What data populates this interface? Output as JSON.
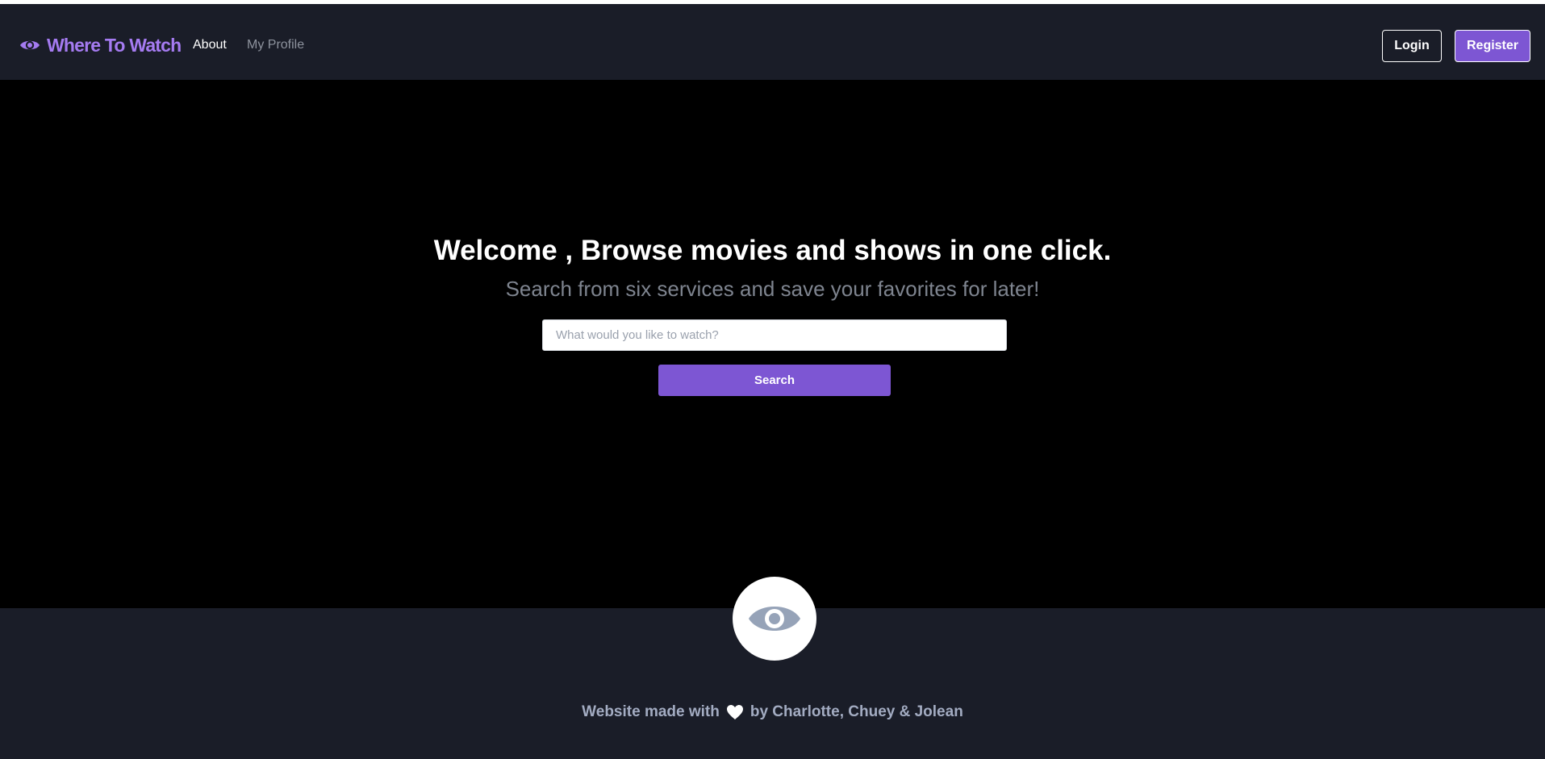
{
  "navbar": {
    "brand": "Where To Watch",
    "links": {
      "about": "About",
      "profile": "My Profile"
    },
    "login_label": "Login",
    "register_label": "Register"
  },
  "hero": {
    "title": "Welcome , Browse movies and shows in one click.",
    "subtitle": "Search from six services and save your favorites for later!",
    "search_placeholder": "What would you like to watch?",
    "search_value": "",
    "search_button": "Search"
  },
  "footer": {
    "text_before": "Website made with",
    "text_after": "by Charlotte, Chuey & Jolean"
  },
  "icons": {
    "brand": "eye-icon",
    "footer_logo": "eye-icon",
    "footer_heart": "heart-icon"
  },
  "colors": {
    "accent": "#7d56d3",
    "brand_text": "#a57bf1",
    "nav_bg": "#1a1d28",
    "hero_bg": "#000000",
    "footer_text": "#a3acc2"
  }
}
